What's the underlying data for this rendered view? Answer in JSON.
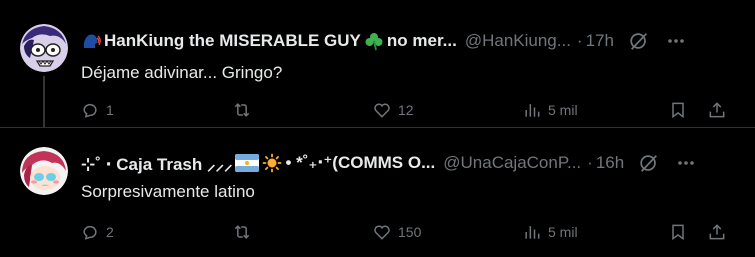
{
  "colors": {
    "background": "#000000",
    "text_primary": "#e7e9ea",
    "text_secondary": "#71767b",
    "divider": "#2f3336"
  },
  "tweets": [
    {
      "display_name": "HanKiung the MISERABLE GUY",
      "display_name_suffix": "no mer...",
      "emoji_leading": "speaking-head-emoji",
      "emoji_trailing": "shamrock-emoji",
      "handle": "@HanKiung...",
      "separator": "·",
      "time": "17h",
      "text": "Déjame adivinar... Gringo?",
      "replies": "1",
      "retweets": "",
      "likes": "12",
      "views": "5 mil"
    },
    {
      "display_name_prefix": "⊹˚ ‧ Caja Trash ⸝⸝⸝",
      "display_name_suffix": "•  *˚₊‧⁺(COMMS O...",
      "emoji_middle": [
        "argentina-flag-emoji",
        "sun-emoji"
      ],
      "handle": "@UnaCajaConP...",
      "separator": "·",
      "time": "16h",
      "text": "Sorpresivamente latino",
      "replies": "2",
      "retweets": "",
      "likes": "150",
      "views": "5 mil"
    }
  ]
}
